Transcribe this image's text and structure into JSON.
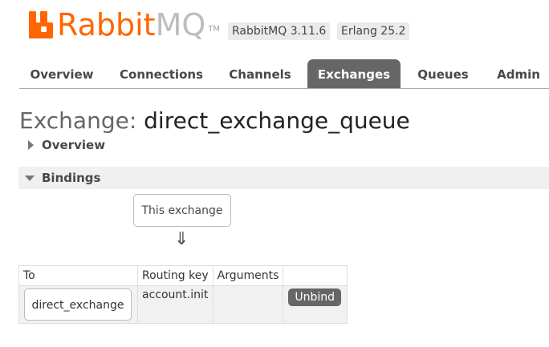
{
  "logo": {
    "text_rabbit": "Rabbit",
    "text_mq": "MQ",
    "tm": "TM"
  },
  "badges": {
    "version": "RabbitMQ 3.11.6",
    "erlang": "Erlang 25.2"
  },
  "tabs": [
    {
      "label": "Overview",
      "active": false
    },
    {
      "label": "Connections",
      "active": false
    },
    {
      "label": "Channels",
      "active": false
    },
    {
      "label": "Exchanges",
      "active": true
    },
    {
      "label": "Queues",
      "active": false
    },
    {
      "label": "Admin",
      "active": false
    }
  ],
  "page": {
    "title_prefix": "Exchange: ",
    "title_name": "direct_exchange_queue"
  },
  "sections": {
    "overview": "Overview",
    "bindings": "Bindings"
  },
  "bindings": {
    "this_exchange_label": "This exchange",
    "arrow": "⇓",
    "headers": {
      "to": "To",
      "routing_key": "Routing key",
      "arguments": "Arguments"
    },
    "rows": [
      {
        "to": "direct_exchange",
        "routing_key": "account.init",
        "arguments": "",
        "action": "Unbind"
      }
    ]
  },
  "colors": {
    "brand_orange": "#ff6600",
    "tab_active_bg": "#666666",
    "logo_grey": "#bdbdbd"
  },
  "icons": {
    "logo": "rabbitmq-logo-icon",
    "collapsed_section": "triangle-right-icon",
    "expanded_section": "triangle-down-icon",
    "flow_arrow": "double-arrow-down-icon"
  }
}
